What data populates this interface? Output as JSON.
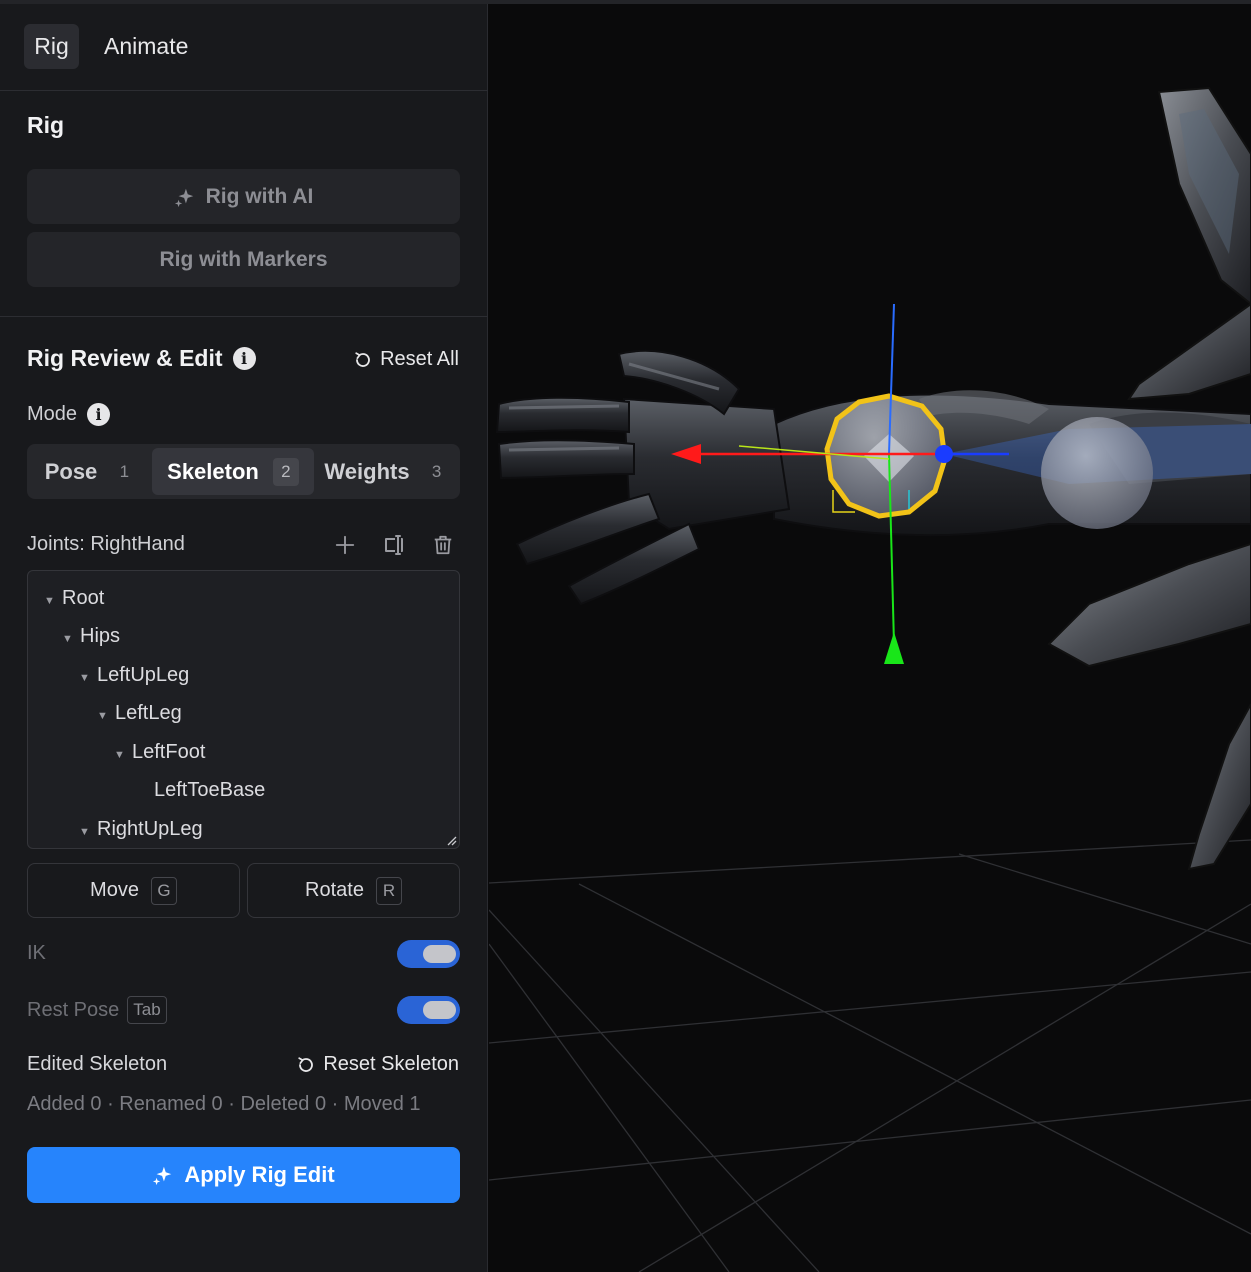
{
  "tabs": [
    {
      "label": "Rig",
      "active": true
    },
    {
      "label": "Animate",
      "active": false
    }
  ],
  "rig_section": {
    "title": "Rig",
    "rig_ai_label": "Rig with AI",
    "rig_markers_label": "Rig with Markers"
  },
  "review": {
    "title": "Rig Review & Edit",
    "reset_all": "Reset All",
    "mode_label": "Mode",
    "modes": [
      {
        "label": "Pose",
        "key": "1"
      },
      {
        "label": "Skeleton",
        "key": "2",
        "active": true
      },
      {
        "label": "Weights",
        "key": "3"
      }
    ],
    "joints_label": "Joints: RightHand",
    "tree": [
      {
        "label": "Root",
        "depth": 0,
        "expandable": true
      },
      {
        "label": "Hips",
        "depth": 1,
        "expandable": true
      },
      {
        "label": "LeftUpLeg",
        "depth": 2,
        "expandable": true
      },
      {
        "label": "LeftLeg",
        "depth": 3,
        "expandable": true
      },
      {
        "label": "LeftFoot",
        "depth": 4,
        "expandable": true
      },
      {
        "label": "LeftToeBase",
        "depth": 5,
        "expandable": false
      },
      {
        "label": "RightUpLeg",
        "depth": 2,
        "expandable": true
      }
    ],
    "move_label": "Move",
    "move_key": "G",
    "rotate_label": "Rotate",
    "rotate_key": "R",
    "ik_label": "IK",
    "ik_on": true,
    "rest_pose_label": "Rest Pose",
    "rest_pose_key": "Tab",
    "rest_pose_on": true,
    "edited_label": "Edited Skeleton",
    "reset_skeleton": "Reset Skeleton",
    "stats": "Added 0 · Renamed 0 · Deleted 0 · Moved 1",
    "apply_label": "Apply Rig Edit"
  },
  "colors": {
    "accent": "#2684fc",
    "toggle_on": "#2a64d6",
    "gizmo_x": "#ff1a1a",
    "gizmo_y": "#19e619",
    "gizmo_z": "#1a3cff",
    "selection": "#f2c318"
  },
  "icons": {
    "add": "plus-icon",
    "rename": "rename-icon",
    "delete": "trash-icon",
    "info": "info-icon",
    "reset": "reset-icon",
    "sparkle": "sparkle-icon"
  }
}
